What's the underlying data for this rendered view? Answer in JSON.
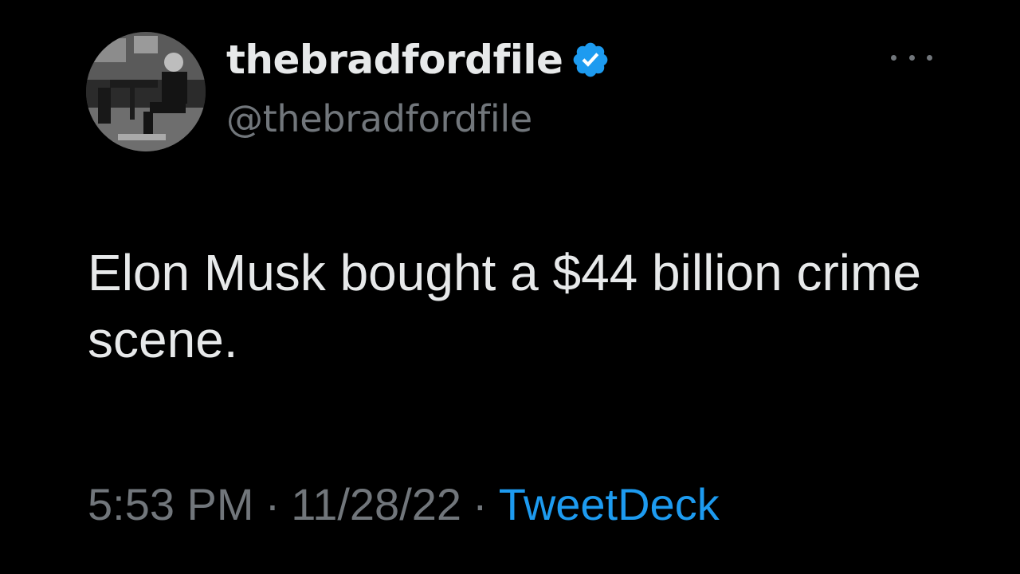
{
  "tweet": {
    "display_name": "thebradfordfile",
    "handle": "@thebradfordfile",
    "verified": true,
    "text": "Elon Musk bought a $44 billion crime scene.",
    "time": "5:53 PM",
    "date": "11/28/22",
    "separator": "·",
    "source": "TweetDeck"
  },
  "icons": {
    "verified": "verified-badge-icon",
    "more": "more-options-icon"
  },
  "colors": {
    "background": "#000000",
    "primary_text": "#e7e9ea",
    "secondary_text": "#71767b",
    "accent": "#1d9bf0"
  }
}
